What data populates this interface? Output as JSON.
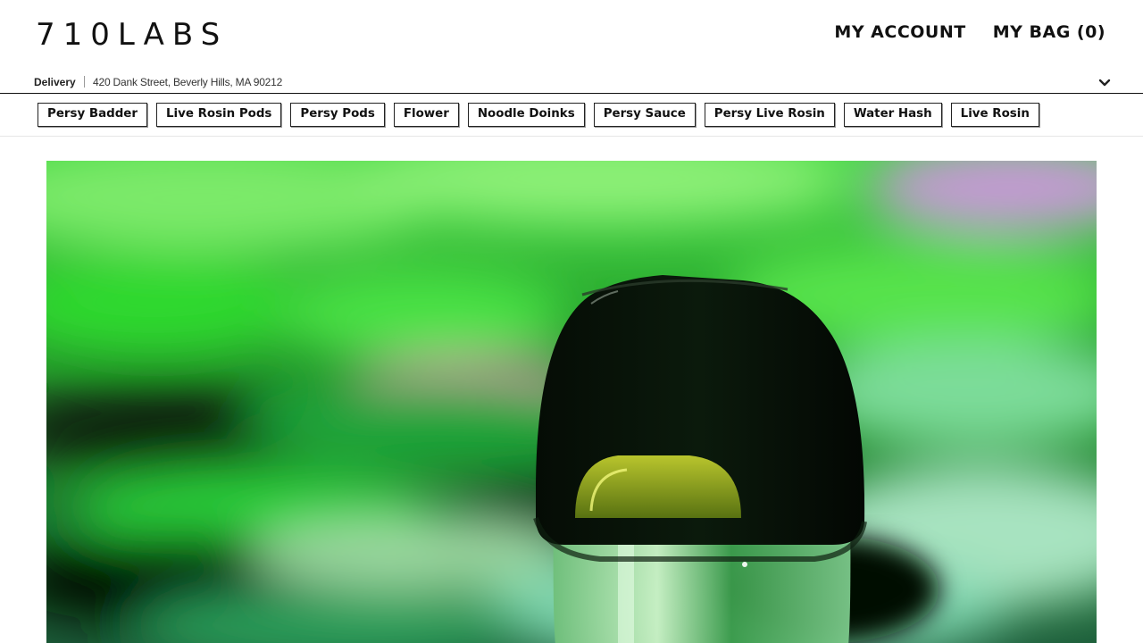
{
  "header": {
    "logo_text": "710LABS",
    "account_label": "MY ACCOUNT",
    "bag_label": "MY BAG (0)"
  },
  "delivery": {
    "mode_label": "Delivery",
    "address": "420 Dank Street, Beverly Hills, MA 90212",
    "dropdown_icon": "chevron-down-icon"
  },
  "categories": [
    "Persy Badder",
    "Live Rosin Pods",
    "Persy Pods",
    "Flower",
    "Noodle Doinks",
    "Persy Sauce",
    "Persy Live Rosin",
    "Water Hash",
    "Live Rosin"
  ],
  "hero": {
    "image_subject": "vape pod on green background"
  },
  "colors": {
    "text": "#111111",
    "background": "#ffffff",
    "hero_green": "#2fc92f"
  }
}
